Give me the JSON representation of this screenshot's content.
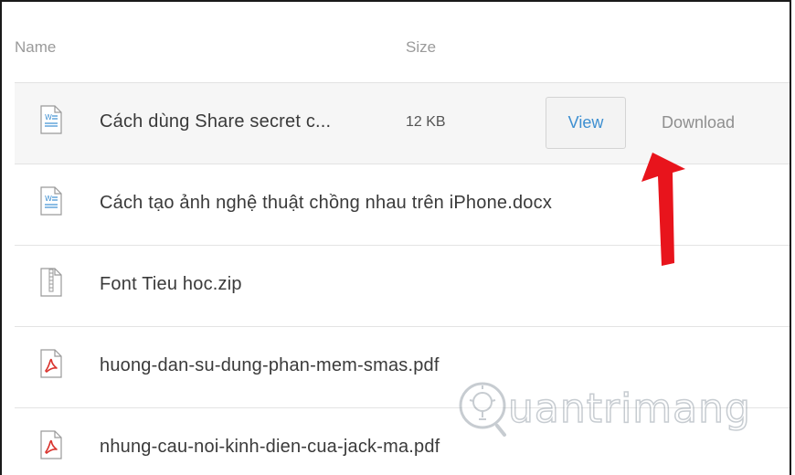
{
  "header": {
    "name_label": "Name",
    "size_label": "Size"
  },
  "files": [
    {
      "name": "Cách dùng Share secret c...",
      "size": "12 KB",
      "type": "word-document-icon",
      "hovered": true,
      "view_label": "View",
      "download_label": "Download"
    },
    {
      "name": "Cách tạo ảnh nghệ thuật chồng nhau trên iPhone.docx",
      "type": "word-document-icon"
    },
    {
      "name": "Font Tieu hoc.zip",
      "type": "zip-archive-icon"
    },
    {
      "name": "huong-dan-su-dung-phan-mem-smas.pdf",
      "type": "pdf-document-icon"
    },
    {
      "name": "nhung-cau-noi-kinh-dien-cua-jack-ma.pdf",
      "type": "pdf-document-icon"
    }
  ],
  "annotation": {
    "arrow_color": "#e8141c",
    "arrow_icon": "red-arrow-pointing-up-icon"
  },
  "watermark": {
    "text": "uantrimang",
    "logo": "quantrimang-logo"
  },
  "colors": {
    "link_blue": "#3d8fd1",
    "pdf_red": "#d9322c",
    "doc_blue": "#3d8fd1"
  }
}
